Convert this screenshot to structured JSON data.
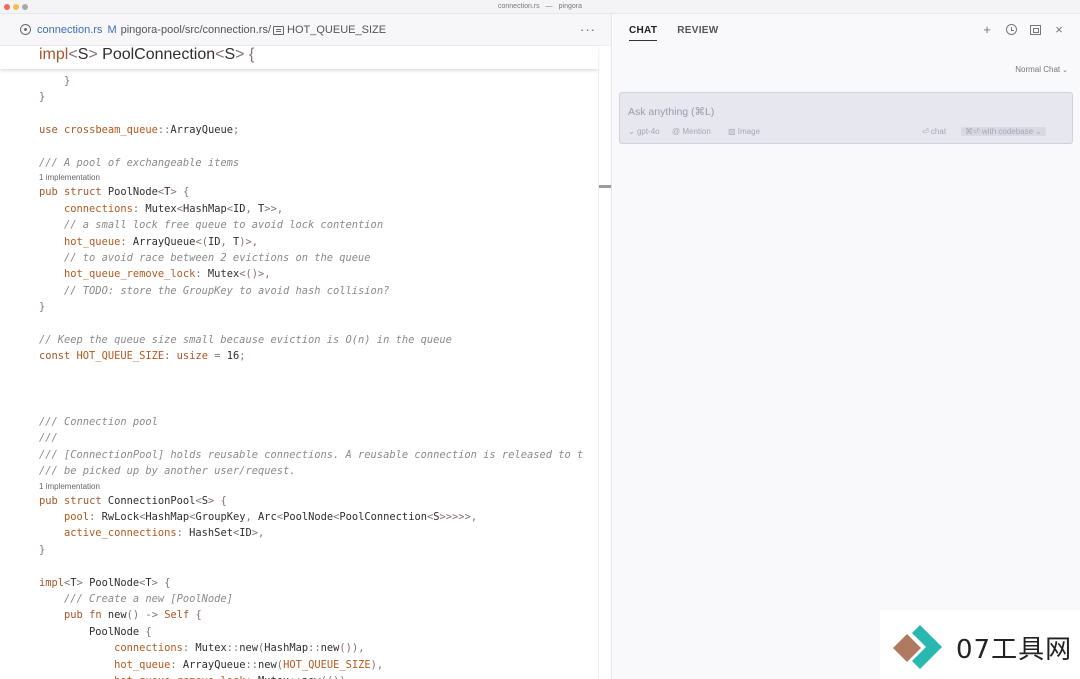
{
  "window": {
    "title_file": "connection.rs",
    "title_project": "pingora"
  },
  "editor": {
    "breadcrumb": {
      "file": "connection.rs",
      "modified": "M",
      "path": "pingora-pool/src/connection.rs/",
      "symbol": "HOT_QUEUE_SIZE"
    },
    "more": "···",
    "sticky_line": "impl<S> PoolConnection<S> {"
  },
  "code_lines": [
    {
      "t": "    }"
    },
    {
      "t": "}"
    },
    {
      "t": ""
    },
    {
      "t": "use crossbeam_queue::ArrayQueue;"
    },
    {
      "t": ""
    },
    {
      "t": "/// A pool of exchangeable items"
    },
    {
      "lens": "1 implementation"
    },
    {
      "t": "pub struct PoolNode<T> {"
    },
    {
      "t": "    connections: Mutex<HashMap<ID, T>>,"
    },
    {
      "t": "    // a small lock free queue to avoid lock contention"
    },
    {
      "t": "    hot_queue: ArrayQueue<(ID, T)>,"
    },
    {
      "t": "    // to avoid race between 2 evictions on the queue"
    },
    {
      "t": "    hot_queue_remove_lock: Mutex<()>,"
    },
    {
      "t": "    // TODO: store the GroupKey to avoid hash collision?"
    },
    {
      "t": "}"
    },
    {
      "t": ""
    },
    {
      "t": "// Keep the queue size small because eviction is O(n) in the queue"
    },
    {
      "t": "const HOT_QUEUE_SIZE: usize = 16;"
    },
    {
      "t": ""
    },
    {
      "t": ""
    },
    {
      "t": ""
    },
    {
      "t": "/// Connection pool"
    },
    {
      "t": "///"
    },
    {
      "t": "/// [ConnectionPool] holds reusable connections. A reusable connection is released to t"
    },
    {
      "t": "/// be picked up by another user/request."
    },
    {
      "lens": "1 implementation"
    },
    {
      "t": "pub struct ConnectionPool<S> {"
    },
    {
      "t": "    pool: RwLock<HashMap<GroupKey, Arc<PoolNode<PoolConnection<S>>>>>,"
    },
    {
      "t": "    active_connections: HashSet<ID>,"
    },
    {
      "t": "}"
    },
    {
      "t": ""
    },
    {
      "t": "impl<T> PoolNode<T> {"
    },
    {
      "t": "    /// Create a new [PoolNode]"
    },
    {
      "t": "    pub fn new() -> Self {"
    },
    {
      "t": "        PoolNode {"
    },
    {
      "t": "            connections: Mutex::new(HashMap::new()),"
    },
    {
      "t": "            hot_queue: ArrayQueue::new(HOT_QUEUE_SIZE),"
    },
    {
      "t": "            hot_queue_remove_lock: Mutex::new(()),"
    }
  ],
  "chat": {
    "tabs": [
      "CHAT",
      "REVIEW"
    ],
    "actions": {
      "add": "+",
      "close": "×"
    },
    "mode": "Normal Chat",
    "input_placeholder": "Ask anything (⌘L)",
    "toolbar": {
      "model": "gpt-4o",
      "mention": "@ Mention",
      "image": "Image",
      "chat": "⏎ chat",
      "codebase": "⌘⏎ with codebase"
    }
  },
  "watermark": {
    "text": "07工具网"
  },
  "colors": {
    "keyword": "#a8552a",
    "comment": "#8a8a8a",
    "field": "#b35a1f",
    "accent": "#3b6fb6"
  }
}
